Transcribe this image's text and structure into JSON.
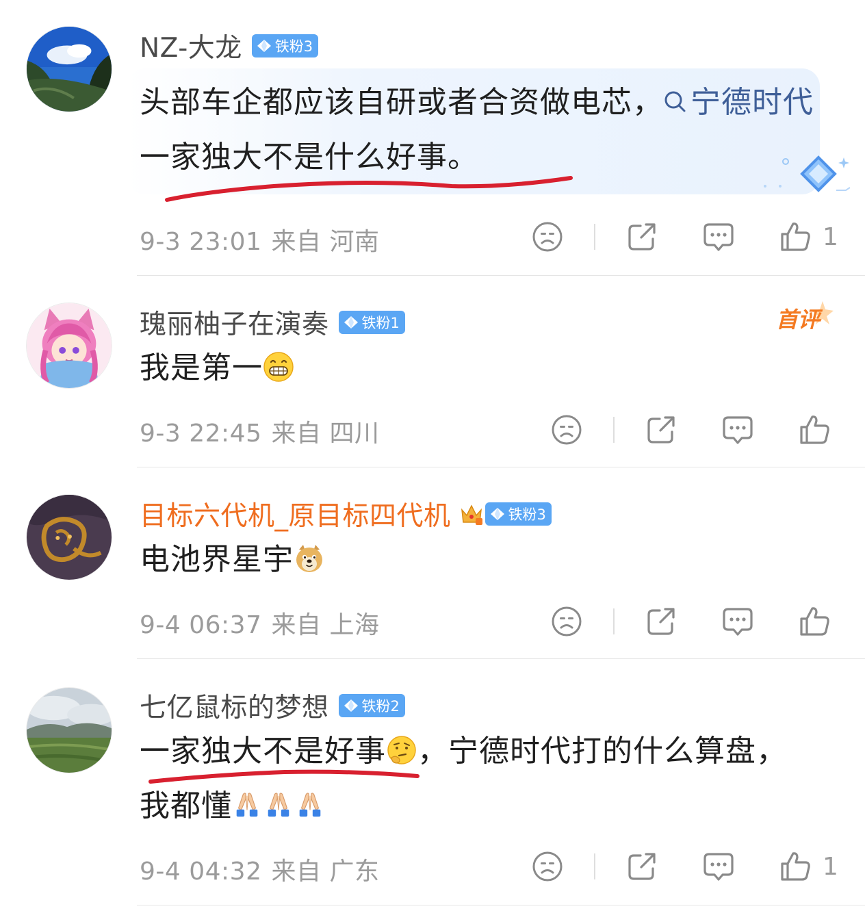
{
  "comments": [
    {
      "username": "NZ-大龙",
      "badge": "铁粉3",
      "text_before": "头部车企都应该自研或者合资做电芯，",
      "topic": "宁德时代",
      "text_after": " 一家独大不是什么好事。",
      "time": "9-3 23:01",
      "from_label": "来自",
      "location": "河南",
      "likes": "1"
    },
    {
      "username": "瑰丽柚子在演奏",
      "badge": "铁粉1",
      "tag": "首评",
      "text": "我是第一",
      "time": "9-3 22:45",
      "from_label": "来自",
      "location": "四川",
      "likes": ""
    },
    {
      "username": "目标六代机_原目标四代机",
      "badge": "铁粉3",
      "text": "电池界星宇",
      "time": "9-4 06:37",
      "from_label": "来自",
      "location": "上海",
      "likes": ""
    },
    {
      "username": "七亿鼠标的梦想",
      "badge": "铁粉2",
      "text_part1": "一家独大不是好事",
      "text_part2": "，宁德时代打的什么算盘，我都懂",
      "time": "9-4 04:32",
      "from_label": "来自",
      "location": "广东",
      "likes": "1"
    }
  ],
  "icons": {
    "dislike": "frown-icon",
    "share": "share-icon",
    "reply": "comment-icon",
    "like": "thumbs-up-icon",
    "topic": "search-icon"
  },
  "colors": {
    "topic": "#3f5f98",
    "orange_name": "#ef6d1f",
    "badge": "#5aa6f4",
    "meta": "#9b9b9b",
    "underline": "#d8202f"
  }
}
